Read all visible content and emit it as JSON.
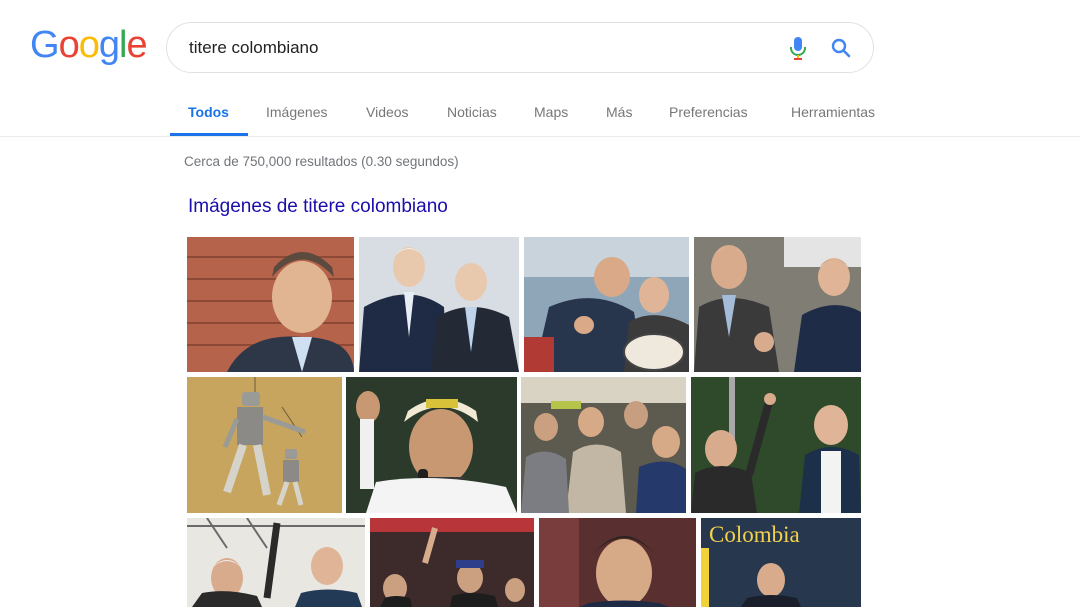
{
  "logo": {
    "letters": [
      "G",
      "o",
      "o",
      "g",
      "l",
      "e"
    ],
    "colors": [
      "#4285f4",
      "#ea4335",
      "#fbbc05",
      "#4285f4",
      "#34a853",
      "#ea4335"
    ]
  },
  "search": {
    "query": "titere colombiano",
    "mic_icon": "microphone-icon",
    "search_icon": "magnifier-icon"
  },
  "tabs": [
    {
      "label": "Todos",
      "active": true
    },
    {
      "label": "Imágenes"
    },
    {
      "label": "Videos"
    },
    {
      "label": "Noticias"
    },
    {
      "label": "Maps"
    },
    {
      "label": "Más"
    },
    {
      "label": "Preferencias"
    },
    {
      "label": "Herramientas"
    }
  ],
  "stats": "Cerca de 750,000 resultados (0.30 segundos)",
  "image_section": {
    "heading": "Imágenes de titere colombiano",
    "tile_text": "Colombia"
  },
  "colors": {
    "accent": "#1a73e8",
    "link": "#1a0dab",
    "muted": "#70757a"
  }
}
